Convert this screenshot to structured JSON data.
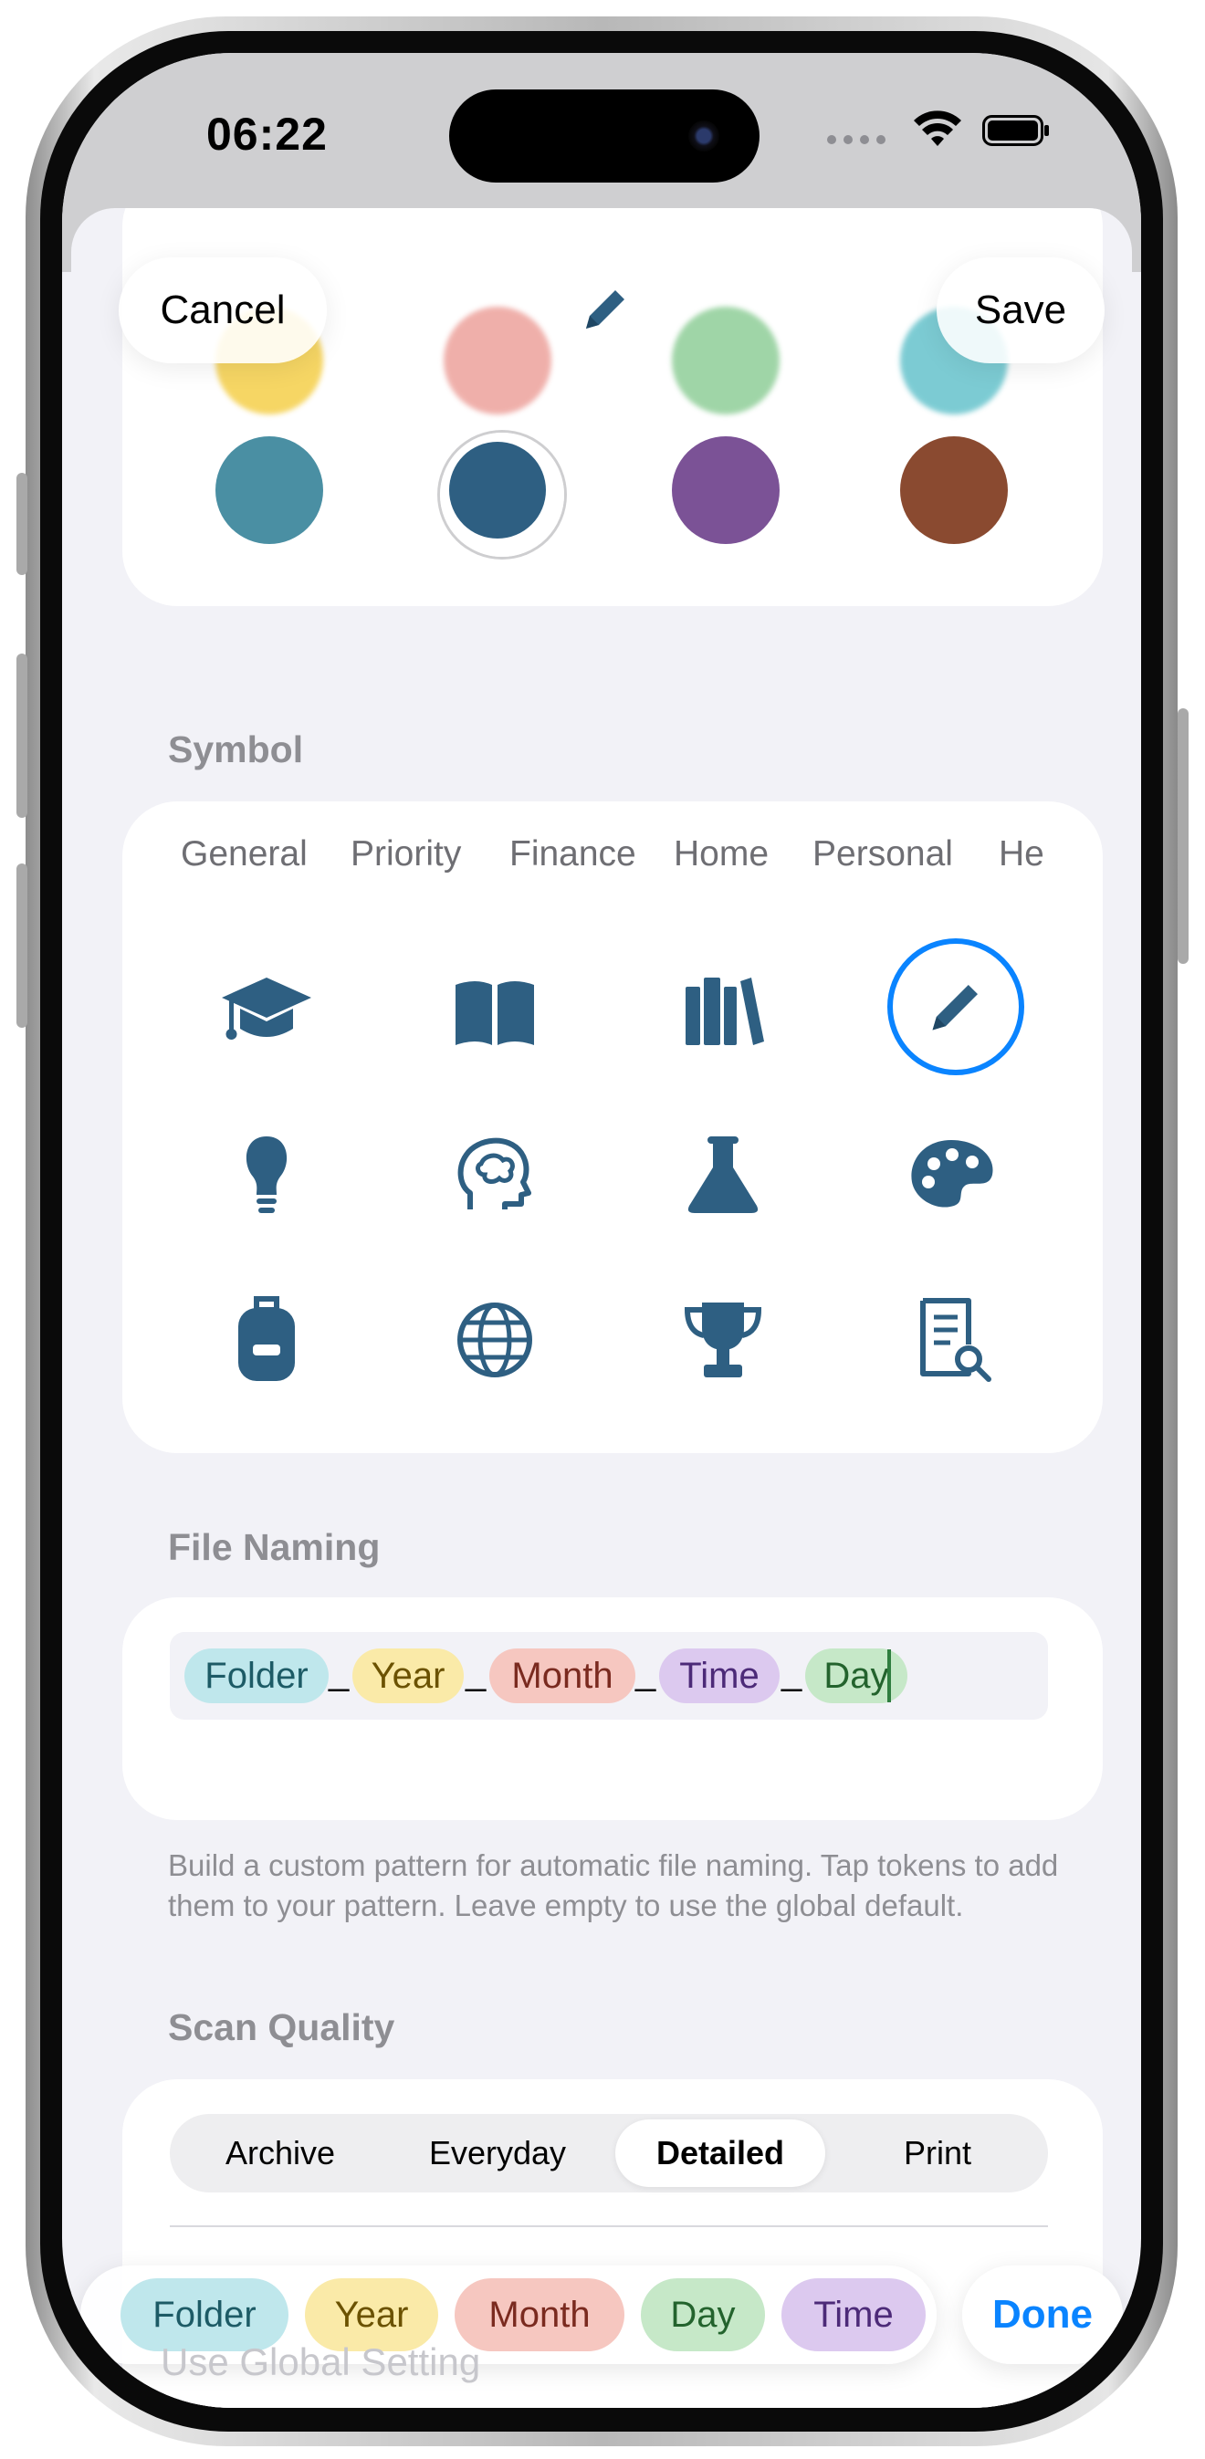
{
  "status_bar": {
    "time": "06:22"
  },
  "nav": {
    "cancel_label": "Cancel",
    "save_label": "Save",
    "header_icon": "pencil-icon"
  },
  "colors": {
    "row1": [
      "#f5cf4a",
      "#eda29c",
      "#8fce98",
      "#66c3cc"
    ],
    "row2": [
      "#4a8fa3",
      "#2e5f82",
      "#7b5296",
      "#8a4a30"
    ],
    "selected": "#2e5f82"
  },
  "symbol": {
    "title": "Symbol",
    "tabs": [
      "General",
      "Priority",
      "Finance",
      "Home",
      "Personal",
      "He"
    ],
    "icons": [
      "graduation-cap-icon",
      "book-icon",
      "books-icon",
      "pencil-icon",
      "lightbulb-icon",
      "brain-icon",
      "flask-icon",
      "palette-icon",
      "backpack-icon",
      "globe-icon",
      "trophy-icon",
      "document-search-icon"
    ],
    "selected_icon": "pencil-icon",
    "icon_color": "#2e5f82",
    "selected_ring_color": "#0a84ff"
  },
  "file_naming": {
    "title": "File Naming",
    "separator": "_",
    "tokens": [
      {
        "label": "Folder",
        "bg": "#bfe7ec",
        "fg": "#1d5b66"
      },
      {
        "label": "Year",
        "bg": "#faeaa8",
        "fg": "#6b5200"
      },
      {
        "label": "Month",
        "bg": "#f6c7c0",
        "fg": "#7a2a1f"
      },
      {
        "label": "Time",
        "bg": "#dcc9ef",
        "fg": "#4c2a78"
      },
      {
        "label": "Day",
        "bg": "#c6e8c8",
        "fg": "#23632d"
      }
    ],
    "helper": "Build a custom pattern for automatic file naming. Tap tokens to add them to your pattern. Leave empty to use the global default."
  },
  "scan_quality": {
    "title": "Scan Quality",
    "options": [
      "Archive",
      "Everyday",
      "Detailed",
      "Print"
    ],
    "selected": "Detailed",
    "global_setting": "Use Global Setting"
  },
  "token_bar": {
    "tokens": [
      {
        "label": "Folder",
        "bg": "#bfe7ec",
        "fg": "#1d5b66"
      },
      {
        "label": "Year",
        "bg": "#faeaa8",
        "fg": "#6b5200"
      },
      {
        "label": "Month",
        "bg": "#f6c7c0",
        "fg": "#7a2a1f"
      },
      {
        "label": "Day",
        "bg": "#c6e8c8",
        "fg": "#23632d"
      },
      {
        "label": "Time",
        "bg": "#dcc9ef",
        "fg": "#4c2a78"
      }
    ],
    "done_label": "Done"
  }
}
